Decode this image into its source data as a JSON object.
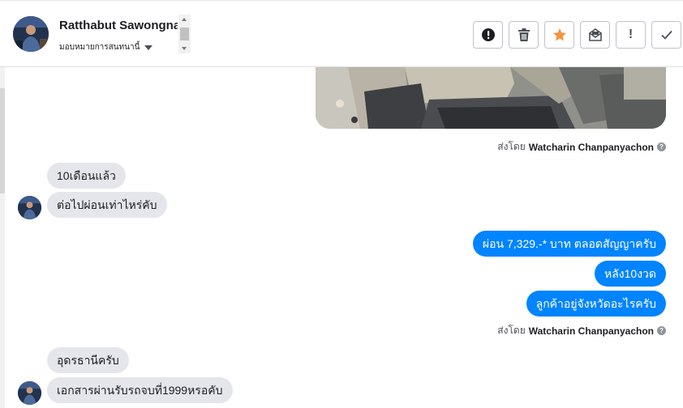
{
  "header": {
    "contact_name": "Ratthabut Sawongnam",
    "assign_label": "มอบหมายการสนทนานี้"
  },
  "actions": [
    {
      "name": "spam-button",
      "icon": "alert-circle-icon"
    },
    {
      "name": "delete-button",
      "icon": "trash-icon"
    },
    {
      "name": "star-button",
      "icon": "star-icon"
    },
    {
      "name": "mark-unread-button",
      "icon": "envelope-open-icon"
    },
    {
      "name": "follow-up-button",
      "icon": "exclamation-icon",
      "glyph": "!"
    },
    {
      "name": "mark-done-button",
      "icon": "checkmark-icon"
    }
  ],
  "colors": {
    "outgoing_bubble": "#0084ff",
    "incoming_bubble": "#e4e6eb",
    "star": "#f7923b"
  },
  "messages": {
    "sent_by_prefix": "ส่งโดย",
    "sent_by_name": "Watcharin Chanpanyachon",
    "in_1": "10เดือนแล้ว",
    "in_2": "ต่อไปผ่อนเท่าไหร่คับ",
    "out_1": "ผ่อน 7,329.-* บาท ตลอดสัญญาครับ",
    "out_2": "หลัง10งวด",
    "out_3": "ลูกค้าอยู่จังหวัดอะไรครับ",
    "in_3": "อุดรธานีครับ",
    "in_4": "เอกสารผ่านรับรถจบที่1999หรอคับ"
  }
}
